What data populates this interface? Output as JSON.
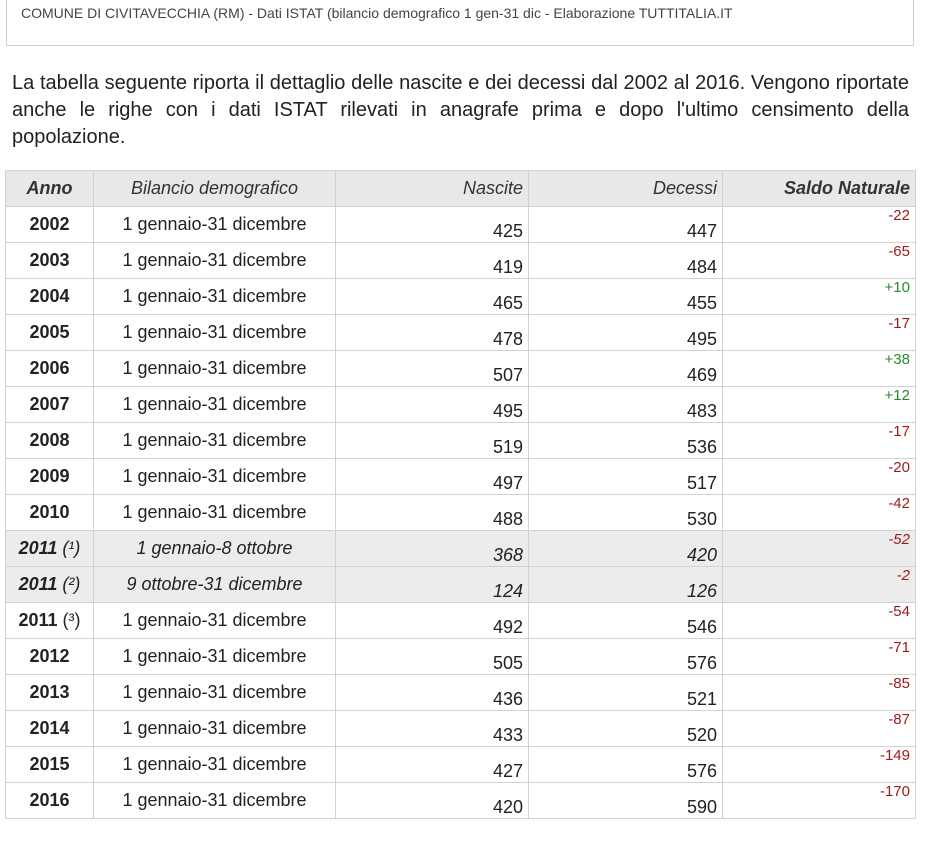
{
  "source": {
    "text": "COMUNE DI CIVITAVECCHIA (RM) - Dati ISTAT (bilancio demografico 1 gen-31 dic - Elaborazione TUTTITALIA.IT"
  },
  "intro": "La tabella seguente riporta il dettaglio delle nascite e dei decessi dal 2002 al 2016. Vengono riportate anche le righe con i dati ISTAT rilevati in anagrafe prima e dopo l'ultimo censimento della popolazione.",
  "table": {
    "headers": [
      "Anno",
      "Bilancio demografico",
      "Nascite",
      "Decessi",
      "Saldo Naturale"
    ],
    "rows": [
      {
        "anno": "2002",
        "note": "",
        "bilancio": "1 gennaio-31 dicembre",
        "nascite": "425",
        "decessi": "447",
        "saldo": "-22",
        "sign": "neg",
        "shaded": false
      },
      {
        "anno": "2003",
        "note": "",
        "bilancio": "1 gennaio-31 dicembre",
        "nascite": "419",
        "decessi": "484",
        "saldo": "-65",
        "sign": "neg",
        "shaded": false
      },
      {
        "anno": "2004",
        "note": "",
        "bilancio": "1 gennaio-31 dicembre",
        "nascite": "465",
        "decessi": "455",
        "saldo": "+10",
        "sign": "pos",
        "shaded": false
      },
      {
        "anno": "2005",
        "note": "",
        "bilancio": "1 gennaio-31 dicembre",
        "nascite": "478",
        "decessi": "495",
        "saldo": "-17",
        "sign": "neg",
        "shaded": false
      },
      {
        "anno": "2006",
        "note": "",
        "bilancio": "1 gennaio-31 dicembre",
        "nascite": "507",
        "decessi": "469",
        "saldo": "+38",
        "sign": "pos",
        "shaded": false
      },
      {
        "anno": "2007",
        "note": "",
        "bilancio": "1 gennaio-31 dicembre",
        "nascite": "495",
        "decessi": "483",
        "saldo": "+12",
        "sign": "pos",
        "shaded": false
      },
      {
        "anno": "2008",
        "note": "",
        "bilancio": "1 gennaio-31 dicembre",
        "nascite": "519",
        "decessi": "536",
        "saldo": "-17",
        "sign": "neg",
        "shaded": false
      },
      {
        "anno": "2009",
        "note": "",
        "bilancio": "1 gennaio-31 dicembre",
        "nascite": "497",
        "decessi": "517",
        "saldo": "-20",
        "sign": "neg",
        "shaded": false
      },
      {
        "anno": "2010",
        "note": "",
        "bilancio": "1 gennaio-31 dicembre",
        "nascite": "488",
        "decessi": "530",
        "saldo": "-42",
        "sign": "neg",
        "shaded": false
      },
      {
        "anno": "2011",
        "note": "(¹)",
        "bilancio": "1 gennaio-8 ottobre",
        "nascite": "368",
        "decessi": "420",
        "saldo": "-52",
        "sign": "neg",
        "shaded": true
      },
      {
        "anno": "2011",
        "note": "(²)",
        "bilancio": "9 ottobre-31 dicembre",
        "nascite": "124",
        "decessi": "126",
        "saldo": "-2",
        "sign": "neg",
        "shaded": true
      },
      {
        "anno": "2011",
        "note": "(³)",
        "bilancio": "1 gennaio-31 dicembre",
        "nascite": "492",
        "decessi": "546",
        "saldo": "-54",
        "sign": "neg",
        "shaded": false
      },
      {
        "anno": "2012",
        "note": "",
        "bilancio": "1 gennaio-31 dicembre",
        "nascite": "505",
        "decessi": "576",
        "saldo": "-71",
        "sign": "neg",
        "shaded": false
      },
      {
        "anno": "2013",
        "note": "",
        "bilancio": "1 gennaio-31 dicembre",
        "nascite": "436",
        "decessi": "521",
        "saldo": "-85",
        "sign": "neg",
        "shaded": false
      },
      {
        "anno": "2014",
        "note": "",
        "bilancio": "1 gennaio-31 dicembre",
        "nascite": "433",
        "decessi": "520",
        "saldo": "-87",
        "sign": "neg",
        "shaded": false
      },
      {
        "anno": "2015",
        "note": "",
        "bilancio": "1 gennaio-31 dicembre",
        "nascite": "427",
        "decessi": "576",
        "saldo": "-149",
        "sign": "neg",
        "shaded": false
      },
      {
        "anno": "2016",
        "note": "",
        "bilancio": "1 gennaio-31 dicembre",
        "nascite": "420",
        "decessi": "590",
        "saldo": "-170",
        "sign": "neg",
        "shaded": false
      }
    ]
  },
  "colors": {
    "negative": "#a01b1b",
    "positive": "#2a8a2a",
    "header_bg": "#e8e8e8",
    "shaded_bg": "#ececec"
  }
}
